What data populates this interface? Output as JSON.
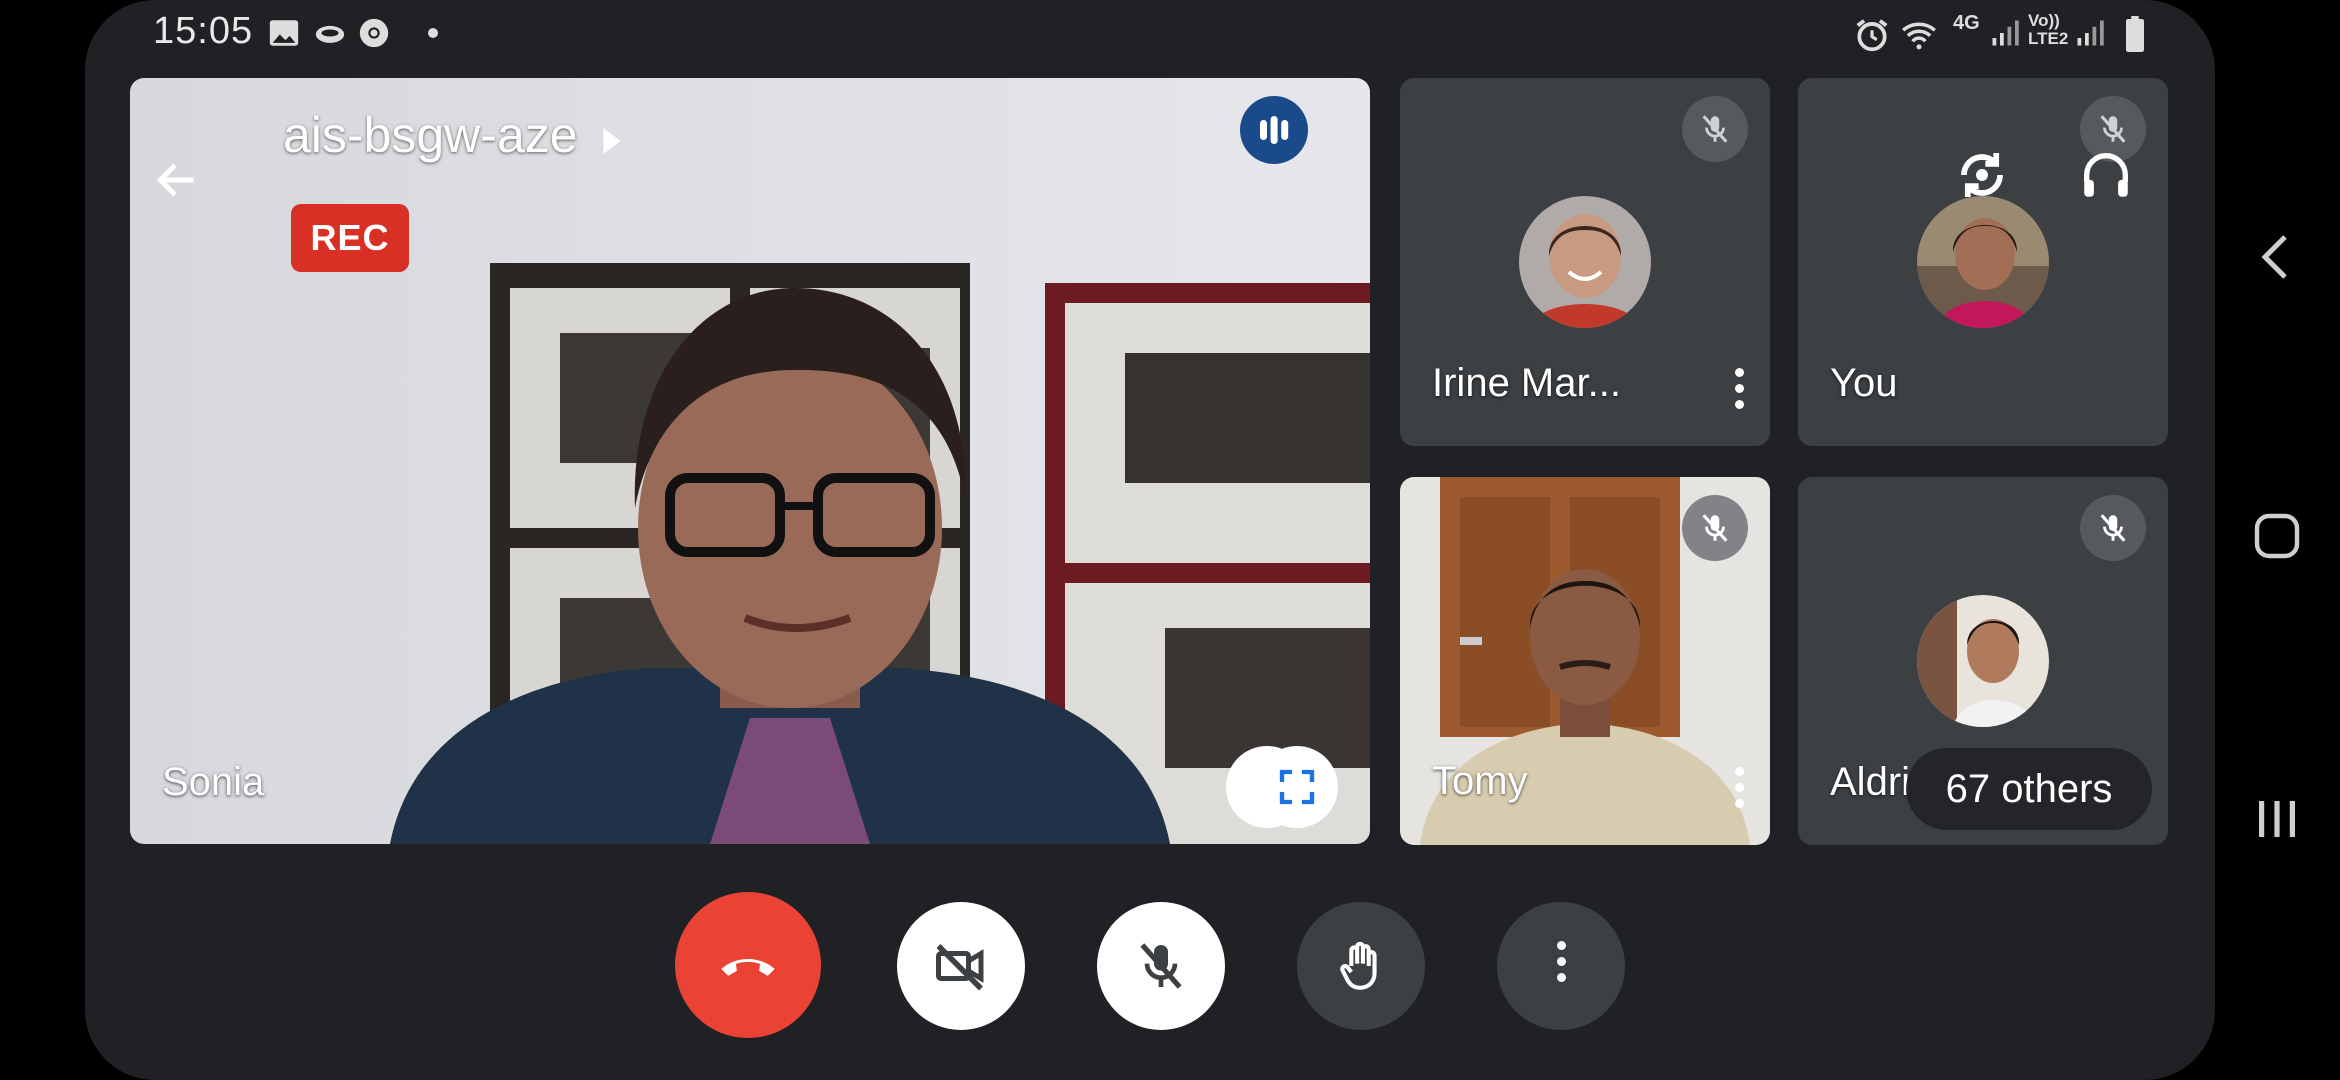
{
  "status_bar": {
    "time": "15:05",
    "left_icons": [
      "gallery-icon",
      "cloud-icon",
      "chrome-icon",
      "dot-icon"
    ],
    "right_icons": [
      "alarm-icon",
      "wifi-icon",
      "signal-icon",
      "signal-icon",
      "battery-icon"
    ],
    "network_label": "4G",
    "volte_label": "Vo))",
    "lte_label": "LTE2"
  },
  "meeting": {
    "code": "ais-bsgw-aze",
    "rec_label": "REC"
  },
  "main_tile": {
    "name": "Sonia"
  },
  "tiles": {
    "t1": {
      "name": "Irine Mar..."
    },
    "t2": {
      "name": "You"
    },
    "t3": {
      "name": "Tomy"
    },
    "t4": {
      "name": "Aldri"
    }
  },
  "others_label": "67 others",
  "controls": [
    "end-call-icon",
    "camera-off-icon",
    "mic-off-icon",
    "raise-hand-icon",
    "more-options-icon"
  ],
  "colors": {
    "end_call": "#ea4335",
    "rec": "#d93025",
    "background": "#202124",
    "tile": "#3c4043",
    "pin_blue": "#1a73e8"
  }
}
